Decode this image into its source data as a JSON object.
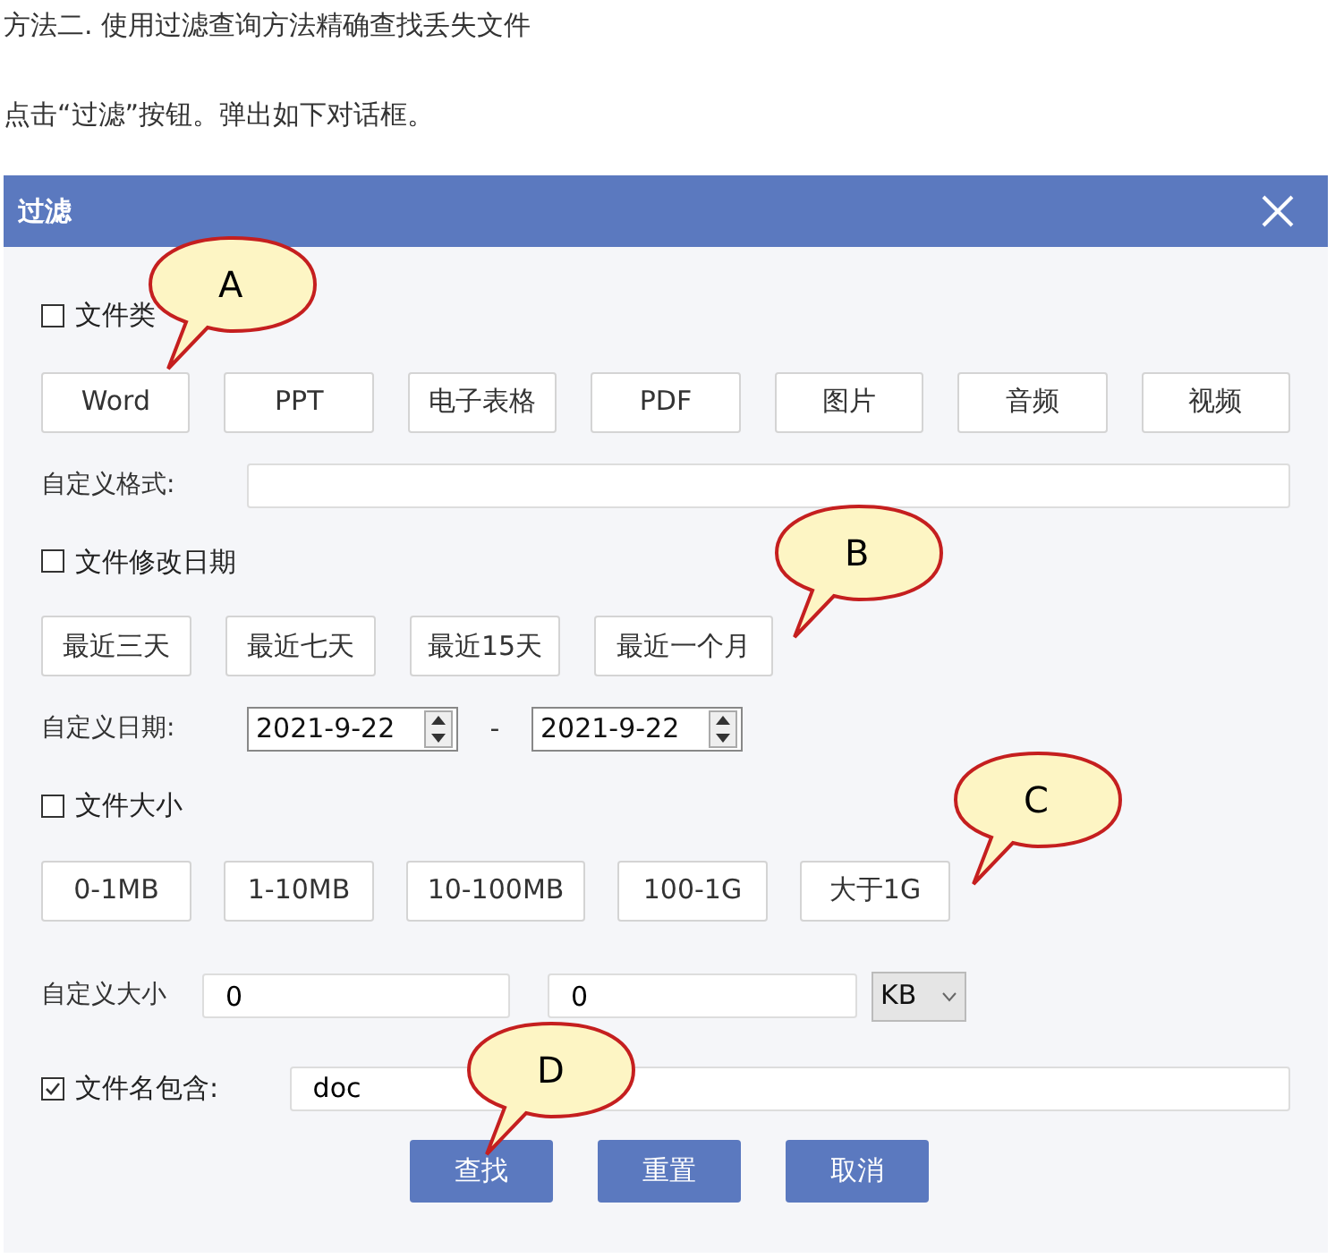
{
  "article": {
    "heading": "方法二. 使用过滤查询方法精确查找丢失文件",
    "instruction": "点击“过滤”按钮。弹出如下对话框。"
  },
  "dialog": {
    "title": "过滤",
    "file_type": {
      "label": "文件类",
      "checked": false,
      "options": [
        "Word",
        "PPT",
        "电子表格",
        "PDF",
        "图片",
        "音频",
        "视频"
      ],
      "custom_label": "自定义格式:"
    },
    "modified_date": {
      "label": "文件修改日期",
      "checked": false,
      "options": [
        "最近三天",
        "最近七天",
        "最近15天",
        "最近一个月"
      ],
      "custom_label": "自定义日期:",
      "from": "2021-9-22",
      "separator": "-",
      "to": "2021-9-22"
    },
    "file_size": {
      "label": "文件大小",
      "checked": false,
      "options": [
        "0-1MB",
        "1-10MB",
        "10-100MB",
        "100-1G",
        "大于1G"
      ],
      "custom_label": "自定义大小",
      "min": "0",
      "max": "0",
      "unit": "KB"
    },
    "name_contains": {
      "label": "文件名包含:",
      "checked": true,
      "value": "doc"
    },
    "buttons": [
      "查找",
      "重置",
      "取消"
    ]
  },
  "callouts": [
    {
      "label": "A"
    },
    {
      "label": "B"
    },
    {
      "label": "C"
    },
    {
      "label": "D"
    }
  ]
}
